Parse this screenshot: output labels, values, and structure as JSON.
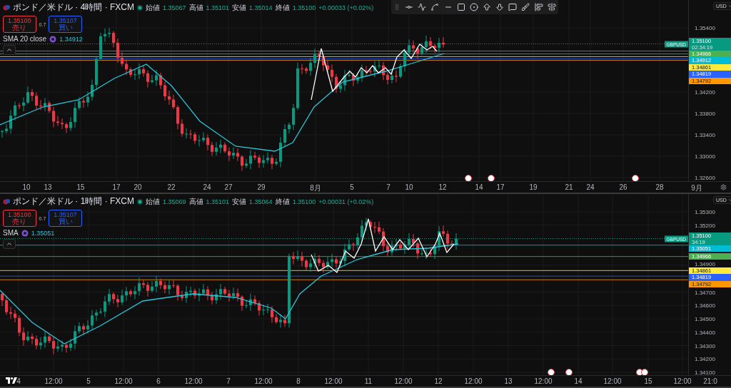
{
  "panes": [
    {
      "title": "ポンド／米ドル · 4時間 · FXCM",
      "ohlc": [
        {
          "label": "始値",
          "value": "1.35067"
        },
        {
          "label": "高値",
          "value": "1.35101"
        },
        {
          "label": "安値",
          "value": "1.35014"
        },
        {
          "label": "終値",
          "value": "1.35100"
        }
      ],
      "change": "+0.00033 (+0.02%)",
      "sell": {
        "price": "1.35100",
        "label": "売り"
      },
      "spread": "0.7",
      "buy": {
        "price": "1.35107",
        "label": "買い"
      },
      "indicator": {
        "name": "SMA",
        "params": "20 close",
        "value": "1.34912"
      },
      "currency": "USD",
      "symbol": "GBPUSD",
      "last": {
        "price": "1.35100",
        "countdown": "02:34:19"
      },
      "price_tags": [
        {
          "value": "1.34966",
          "color": "#4caf50"
        },
        {
          "value": "1.34912",
          "color": "#00bcd4"
        },
        {
          "value": "1.34861",
          "color": "#ffeb3b"
        },
        {
          "value": "1.34819",
          "color": "#2962ff"
        },
        {
          "value": "1.34792",
          "color": "#ff9800"
        }
      ],
      "y_ticks": [
        "1.35400",
        "1.34200",
        "1.33800",
        "1.33400",
        "1.33000",
        "1.32600"
      ],
      "x_ticks": [
        "10",
        "13",
        "15",
        "17",
        "20",
        "22",
        "24",
        "27",
        "29",
        "8月",
        "5",
        "7",
        "10",
        "12",
        "14",
        "17",
        "19",
        "21",
        "24",
        "26",
        "28",
        "9月"
      ]
    },
    {
      "title": "ポンド／米ドル · 1時間 · FXCM",
      "ohlc": [
        {
          "label": "始値",
          "value": "1.35069"
        },
        {
          "label": "高値",
          "value": "1.35101"
        },
        {
          "label": "安値",
          "value": "1.35064"
        },
        {
          "label": "終値",
          "value": "1.35100"
        }
      ],
      "change": "+0.00031 (+0.02%)",
      "sell": {
        "price": "1.35100",
        "label": "売り"
      },
      "spread": "0.7",
      "buy": {
        "price": "1.35107",
        "label": "買い"
      },
      "indicator": {
        "name": "SMA",
        "value": "1.35051"
      },
      "currency": "USD",
      "symbol": "GBPUSD",
      "last": {
        "price": "1.35100",
        "countdown": "34:19"
      },
      "price_tags": [
        {
          "value": "1.35051",
          "color": "#00bcd4"
        },
        {
          "value": "1.34966",
          "color": "#4caf50"
        },
        {
          "value": "1.34861",
          "color": "#ffeb3b"
        },
        {
          "value": "1.34819",
          "color": "#2962ff"
        },
        {
          "value": "1.34792",
          "color": "#ff9800"
        }
      ],
      "y_ticks": [
        "1.35300",
        "1.35200",
        "1.34900",
        "1.34700",
        "1.34600",
        "1.34500",
        "1.34400",
        "1.34300",
        "1.34200",
        "1.34100"
      ],
      "x_ticks": [
        "4",
        "12:00",
        "5",
        "12:00",
        "6",
        "12:00",
        "7",
        "12:00",
        "8",
        "12:00",
        "11",
        "12:00",
        "12",
        "12:00",
        "13",
        "12:00",
        "14",
        "12:00",
        "15",
        "12:00",
        "21:0"
      ]
    }
  ]
}
